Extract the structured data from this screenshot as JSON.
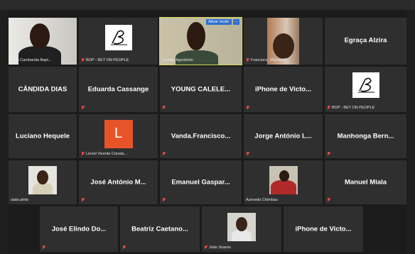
{
  "controls": {
    "mute_button": "Ativar mudo",
    "more_button": "···"
  },
  "tiles": [
    {
      "name": "ucas Cambanda Bapt..."
    },
    {
      "name": "BOP - BET ON PEOPLE"
    },
    {
      "name": "Vicente Agostinho"
    },
    {
      "name": "Francisco_Manuel/C..."
    },
    {
      "name": "Egraça Alzira"
    },
    {
      "name": "CÂNDIDA DIAS"
    },
    {
      "name": "Eduarda Cassange"
    },
    {
      "name": "YOUNG CALELE..."
    },
    {
      "name": "iPhone de Victo..."
    },
    {
      "name": "BOP - BET ON PEOPLE"
    },
    {
      "name": "Luciano Hequele"
    },
    {
      "name": "Lionel Vicente Consta...",
      "initial": "L"
    },
    {
      "name": "Vanda.Francisco..."
    },
    {
      "name": "Jorge António L..."
    },
    {
      "name": "Manhonga Bern..."
    },
    {
      "name": "uiala pinto"
    },
    {
      "name": "José António M..."
    },
    {
      "name": "Emanuel Gaspar..."
    },
    {
      "name": "Azevedo Chimbau"
    },
    {
      "name": "Manuel Miala"
    },
    {
      "name": "José Elindo Do..."
    },
    {
      "name": "Beatriz Caetano..."
    },
    {
      "name": "João Soares"
    },
    {
      "name": "iPhone de Victo..."
    }
  ]
}
